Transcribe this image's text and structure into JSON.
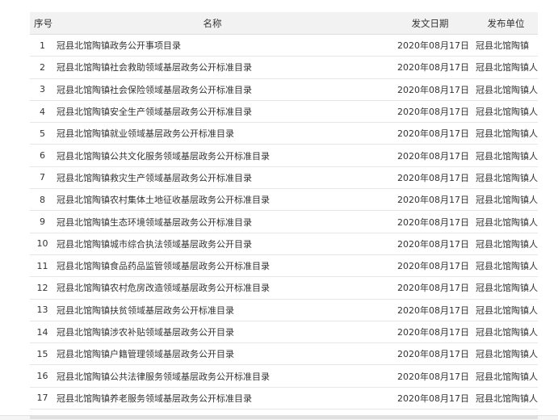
{
  "headers": {
    "index": "序号",
    "name": "名称",
    "date": "发文日期",
    "unit": "发布单位"
  },
  "rows": [
    {
      "index": "1",
      "name": "冠县北馆陶镇政务公开事项目录",
      "date": "2020年08月17日",
      "unit": "冠县北馆陶镇"
    },
    {
      "index": "2",
      "name": "冠县北馆陶镇社会救助领域基层政务公开标准目录",
      "date": "2020年08月17日",
      "unit": "冠县北馆陶镇人民政府"
    },
    {
      "index": "3",
      "name": "冠县北馆陶镇社会保险领域基层政务公开标准目录",
      "date": "2020年08月17日",
      "unit": "冠县北馆陶镇人民政府"
    },
    {
      "index": "4",
      "name": "冠县北馆陶镇安全生产领域基层政务公开标准目录",
      "date": "2020年08月17日",
      "unit": "冠县北馆陶镇人民政府"
    },
    {
      "index": "5",
      "name": "冠县北馆陶镇就业领域基层政务公开标准目录",
      "date": "2020年08月17日",
      "unit": "冠县北馆陶镇人民政府"
    },
    {
      "index": "6",
      "name": "冠县北馆陶镇公共文化服务领域基层政务公开标准目录",
      "date": "2020年08月17日",
      "unit": "冠县北馆陶镇人民政府"
    },
    {
      "index": "7",
      "name": "冠县北馆陶镇救灾生产领域基层政务公开标准目录",
      "date": "2020年08月17日",
      "unit": "冠县北馆陶镇人民政府"
    },
    {
      "index": "8",
      "name": "冠县北馆陶镇农村集体土地征收基层政务公开标准目录",
      "date": "2020年08月17日",
      "unit": "冠县北馆陶镇人民政府"
    },
    {
      "index": "9",
      "name": "冠县北馆陶镇生态环境领域基层政务公开标准目录",
      "date": "2020年08月17日",
      "unit": "冠县北馆陶镇人民政府"
    },
    {
      "index": "10",
      "name": "冠县北馆陶镇城市综合执法领域基层政务公开目录",
      "date": "2020年08月17日",
      "unit": "冠县北馆陶镇人民政府"
    },
    {
      "index": "11",
      "name": "冠县北馆陶镇食品药品监管领域基层政务公开标准目录",
      "date": "2020年08月17日",
      "unit": "冠县北馆陶镇人民政府"
    },
    {
      "index": "12",
      "name": "冠县北馆陶镇农村危房改造领域基层政务公开标准目录",
      "date": "2020年08月17日",
      "unit": "冠县北馆陶镇人民政府"
    },
    {
      "index": "13",
      "name": "冠县北馆陶镇扶贫领域基层政务公开标准目录",
      "date": "2020年08月17日",
      "unit": "冠县北馆陶镇人民政府"
    },
    {
      "index": "14",
      "name": "冠县北馆陶镇涉农补贴领域基层政务公开目录",
      "date": "2020年08月17日",
      "unit": "冠县北馆陶镇人民政府"
    },
    {
      "index": "15",
      "name": "冠县北馆陶镇户籍管理领域基层政务公开目录",
      "date": "2020年08月17日",
      "unit": "冠县北馆陶镇人民政府"
    },
    {
      "index": "16",
      "name": "冠县北馆陶镇公共法律服务领域基层政务公开标准目录",
      "date": "2020年08月17日",
      "unit": "冠县北馆陶镇人民政府"
    },
    {
      "index": "17",
      "name": "冠县北馆陶镇养老服务领域基层政务公开标准目录",
      "date": "2020年08月17日",
      "unit": "冠县北馆陶镇人民政府"
    }
  ]
}
